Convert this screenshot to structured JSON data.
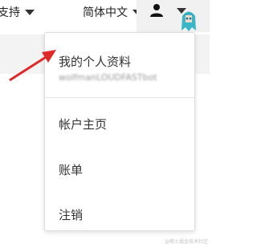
{
  "topbar": {
    "support_label": "支持",
    "language_label": "简体中文"
  },
  "user_menu": {
    "items": [
      {
        "label": "我的个人资料",
        "subtext": "wolfmanLOUDFASTbot"
      },
      {
        "label": "帐户主页"
      },
      {
        "label": "账单"
      },
      {
        "label": "注销"
      }
    ]
  },
  "annotation": {
    "arrow_color": "#e02828"
  },
  "watermark": "@稀土掘金技术社区"
}
